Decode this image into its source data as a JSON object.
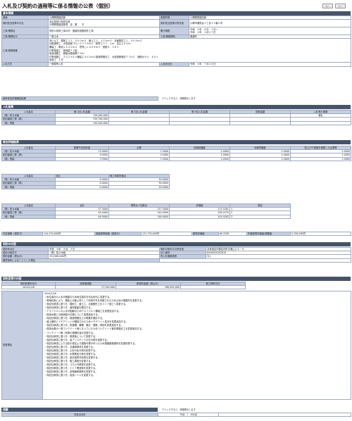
{
  "page": {
    "title": "入札及び契約の過程等に係る情報の公表（個別）",
    "nav_prev": "前へ",
    "nav_next": "次へ"
  },
  "basic": {
    "heading": "基本情報",
    "dept_label": "部局",
    "dept_value": "小樽開発建設部",
    "office_label": "事務所等",
    "office_value": "小樽開発建設部",
    "officer_label": "契約担当官等の氏名",
    "officer_line1": "支出負担行為担当官",
    "officer_line2": "小樽開発建設部長　遠　藤　　平",
    "officer_addr_label": "契約担当官等の所在地",
    "officer_addr_value": "小樽市潮見台１丁目１５番５号",
    "work_name_label": "工事/業務名",
    "work_name_value": "見別川改修工事の内　蘭越河道掘削外工事",
    "period_label": "履行期間",
    "period_from": "令和　５年　８月　７日〜",
    "period_to": "令和　６年　２月２７日",
    "category_label": "工事/業務区分",
    "category_value": "一般土木",
    "place_label": "工事/業務場所",
    "place_value": "蘭越町",
    "summary_label": "工事/業務概要",
    "summary_lines": [
      "河川土工　掘削工１２，５００ｍ３　盛土工２，１００ｍ３　法面整形工１，４００ｍ２",
      "法覆護岸工　大型連節ブロック３７６ｍ２　積寄工３７．２ｍ　法止工６４ｍ",
      "舗装工　車道１６２０ｍ３　境界しｃ４００ｍ３　鉄筋５．３８ｔ",
      "付帯施設工　側溝蓋７２組",
      "仮設道路工　鋼製水路設備７９ｍ",
      "付帯道路工　アスファルト舗装工４６５ｍ２構造物撤去工　大型連節撤去７７ｍ２　樋柏分９０．８０ｔ",
      "仮設工　１式"
    ],
    "method_label": "入札方式",
    "method_value": "一般競争入札",
    "bid_date_label": "入札年月日",
    "bid_date_value": "令和　５年　７月２８日"
  },
  "competition": {
    "label": "競争参加資格確認結果",
    "note": "クリックすると、詳細表示します"
  },
  "bid_results": {
    "heading": "入札結果",
    "headers": [
      "入札者名",
      "第１回入札金額",
      "第２回入札金額",
      "第３回入札金額",
      "見積金額",
      "入札等の措置"
    ],
    "rows": [
      [
        "（株）佐々木組",
        "139,000,000",
        "",
        "",
        "",
        "落札"
      ],
      [
        "松田建設工業（株）",
        "139,780,000",
        "",
        "",
        "",
        ""
      ],
      [
        "（株）勇組",
        "140,000,000",
        "",
        "",
        "",
        ""
      ]
    ]
  },
  "evaluation": {
    "heading": "総合評価結果",
    "table1_headers": [
      "入札者名",
      "配置予定技術者",
      "企業",
      "地域精通度",
      "地域貢献度",
      "週上げや実施を優越した企業等"
    ],
    "table1_rows": [
      [
        "（株）佐々木組",
        "13.0000",
        "7.4000",
        "2.0000",
        "2.0000",
        "2.0000"
      ],
      [
        "松田建設工業（株）",
        "9.0000",
        "3.4000",
        "2.0000",
        "2.0000",
        "2.0000"
      ],
      [
        "（株）勇組",
        "3.5000",
        "7.4000",
        "2.0000",
        "2.0000",
        "2.0000"
      ]
    ],
    "table2_headers": [
      "入札者名",
      "施工",
      "施工体制評価点"
    ],
    "table2_rows": [
      [
        "（株）佐々木組",
        "0.0000",
        "30.0000"
      ],
      [
        "松田建設工業（株）",
        "0.0000",
        "30.0000"
      ],
      [
        "（株）勇組",
        "0.0000",
        "30.0000"
      ]
    ],
    "table3_headers": [
      "入札者名",
      "合計",
      "標準点＋加算点",
      "評価値",
      "順位"
    ],
    "table3_rows": [
      [
        "（株）佐々木組",
        "37.3000",
        "137.3000",
        "113.5281",
        "1"
      ],
      [
        "松田建設工業（株）",
        "40.4000",
        "140.4000",
        "100.2270",
        "2"
      ],
      [
        "（株）勇組",
        "46.9000",
        "146.9000",
        "104.9285",
        "3"
      ]
    ]
  },
  "price": {
    "planned_label": "予定価格（税抜き）",
    "planned_value": "144,470,000円",
    "survey_label": "調査基準価格（税抜き）",
    "survey_value": "131,750,000円",
    "standard_label": "基準評価値",
    "standard_value": "69.2585",
    "exclusion_label": "失格基準評価値/調整値",
    "exclusion_value": "5,706,565円"
  },
  "contract": {
    "heading": "契約の内容",
    "date_label": "契約年月日",
    "date_value": "令和　５年　８月　３日",
    "partner_addr_label": "契約の相手方の所在地",
    "partner_addr_value": "北海道岩内郡岩内町字東山２６－８",
    "partner_label": "契約の相手方",
    "partner_value": "（株）佐々木組",
    "corp_no_label": "法人番号",
    "corp_no_value": "8430001052815",
    "amount_label": "契約金額（税込み）",
    "amount_value": "152,680,000円",
    "low_label": "低入札価格調査",
    "low_value": "なし",
    "lead_label": "随意契約によることとした理由",
    "lead_value": ""
  },
  "change": {
    "heading": "契約変更の内容",
    "headers": [
      "契約変更年月日",
      "変更増減額",
      "新契約金額（税込み）",
      "新工期年月日"
    ],
    "row": [
      "2024/2/26",
      "27,940,000",
      "180,620,000",
      ""
    ],
    "reason_label": "変更理由",
    "reason_lines": [
      "2024/2/26",
      "・両生保存の入手が困難なため両生保存を切込砂石に変更する。",
      "・現地精査により、掘削土が盛土材として利用不可を判断されたため土砂の運搬先を変更する。",
      "・特記仕様書に基づき、掘削工、盛土工、法面整形工をＩＣＴ施工へ変更する。",
      "・特記仕様書に基づき、護岸旋盤を撤去する。",
      "・アスファルトの入手が困難なためアスファルト舗装工を変更追加する。",
      "・既設水路との接続部の位置について変更追加する。",
      "・特記仕様書に基づき、構造物撤去工の規格を確定する。",
      "・盛土箇所にイチデリットが確認されたためイチデリット拡去を変更追加する。",
      "・特記仕様書に基づき、防護柵、横柵、撤去・運搬・荷卸を変更追加する。",
      "・既設水路の一部コンクリート管となっていたためコンクリート管存置撤去工を変更追加する。",
      "・コンクリート鞘（有筋の運搬料金を変更する。",
      "・特記仕様書に基づき、敷鉄板について変更する。",
      "・特記仕様書に基づき、高ブリスチックの仕分費を精算する。",
      "・特記仕様書により当初の想定より掘削作業が伴ったため運搬路基礎材を変更精算する。",
      "・特記仕様書に基づき、交通誘導員を変更する。",
      "・特記仕様書に基づき、土砂の処分費を精算する。",
      "・特記仕様書に基づき、木根等処分費を変更する。",
      "・特記仕様書に基づき、設計図書作成費を変更する。",
      "・特記仕様書に基づき、施工調査を変更する。",
      "・特記仕様書に基づき、コロナ対策費を変更する。",
      "・特記仕様書に基づき、ＩＣＴ関連費を変更する。",
      "・特記仕様書に基づき、送電線総務費を変更する。",
      "・特記仕様書に基づき、仮設トイレを変更する。"
    ]
  },
  "results": {
    "heading": "成績",
    "note": "クリックすると、詳細表示します",
    "eval_label": "評定点合計",
    "eval_value": "79点　/　100点"
  }
}
